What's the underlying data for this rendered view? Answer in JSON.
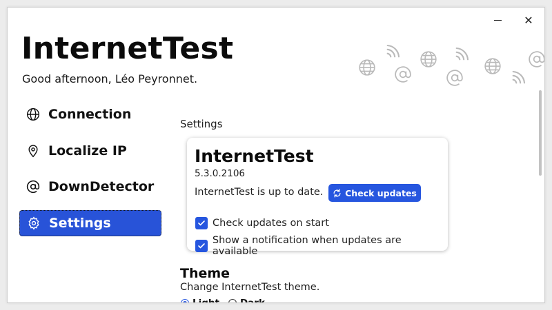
{
  "app": {
    "title": "InternetTest",
    "greeting": "Good afternoon, Léo Peyronnet."
  },
  "window_controls": {
    "minimize_icon": "minimize-icon",
    "close_glyph": "✕"
  },
  "sidebar": {
    "items": [
      {
        "label": "Connection",
        "icon": "globe-icon",
        "active": false
      },
      {
        "label": "Localize IP",
        "icon": "location-pin-icon",
        "active": false
      },
      {
        "label": "DownDetector",
        "icon": "at-sign-icon",
        "active": false
      },
      {
        "label": "Settings",
        "icon": "gear-icon",
        "active": true
      }
    ]
  },
  "main": {
    "section_label": "Settings",
    "update_card": {
      "title": "InternetTest",
      "version": "5.3.0.2106",
      "status": "InternetTest is up to date.",
      "check_button": "Check updates",
      "options": [
        {
          "label": "Check updates on start",
          "checked": true
        },
        {
          "label": "Show a notification when updates are available",
          "checked": true
        }
      ]
    },
    "theme": {
      "title": "Theme",
      "description": "Change InternetTest theme.",
      "options": [
        {
          "label": "Light",
          "selected": true
        },
        {
          "label": "Dark",
          "selected": false
        }
      ]
    }
  },
  "colors": {
    "accent": "#2656df",
    "nav_active_bg": "#2853d8",
    "decor_icon": "#b9b9b9"
  }
}
